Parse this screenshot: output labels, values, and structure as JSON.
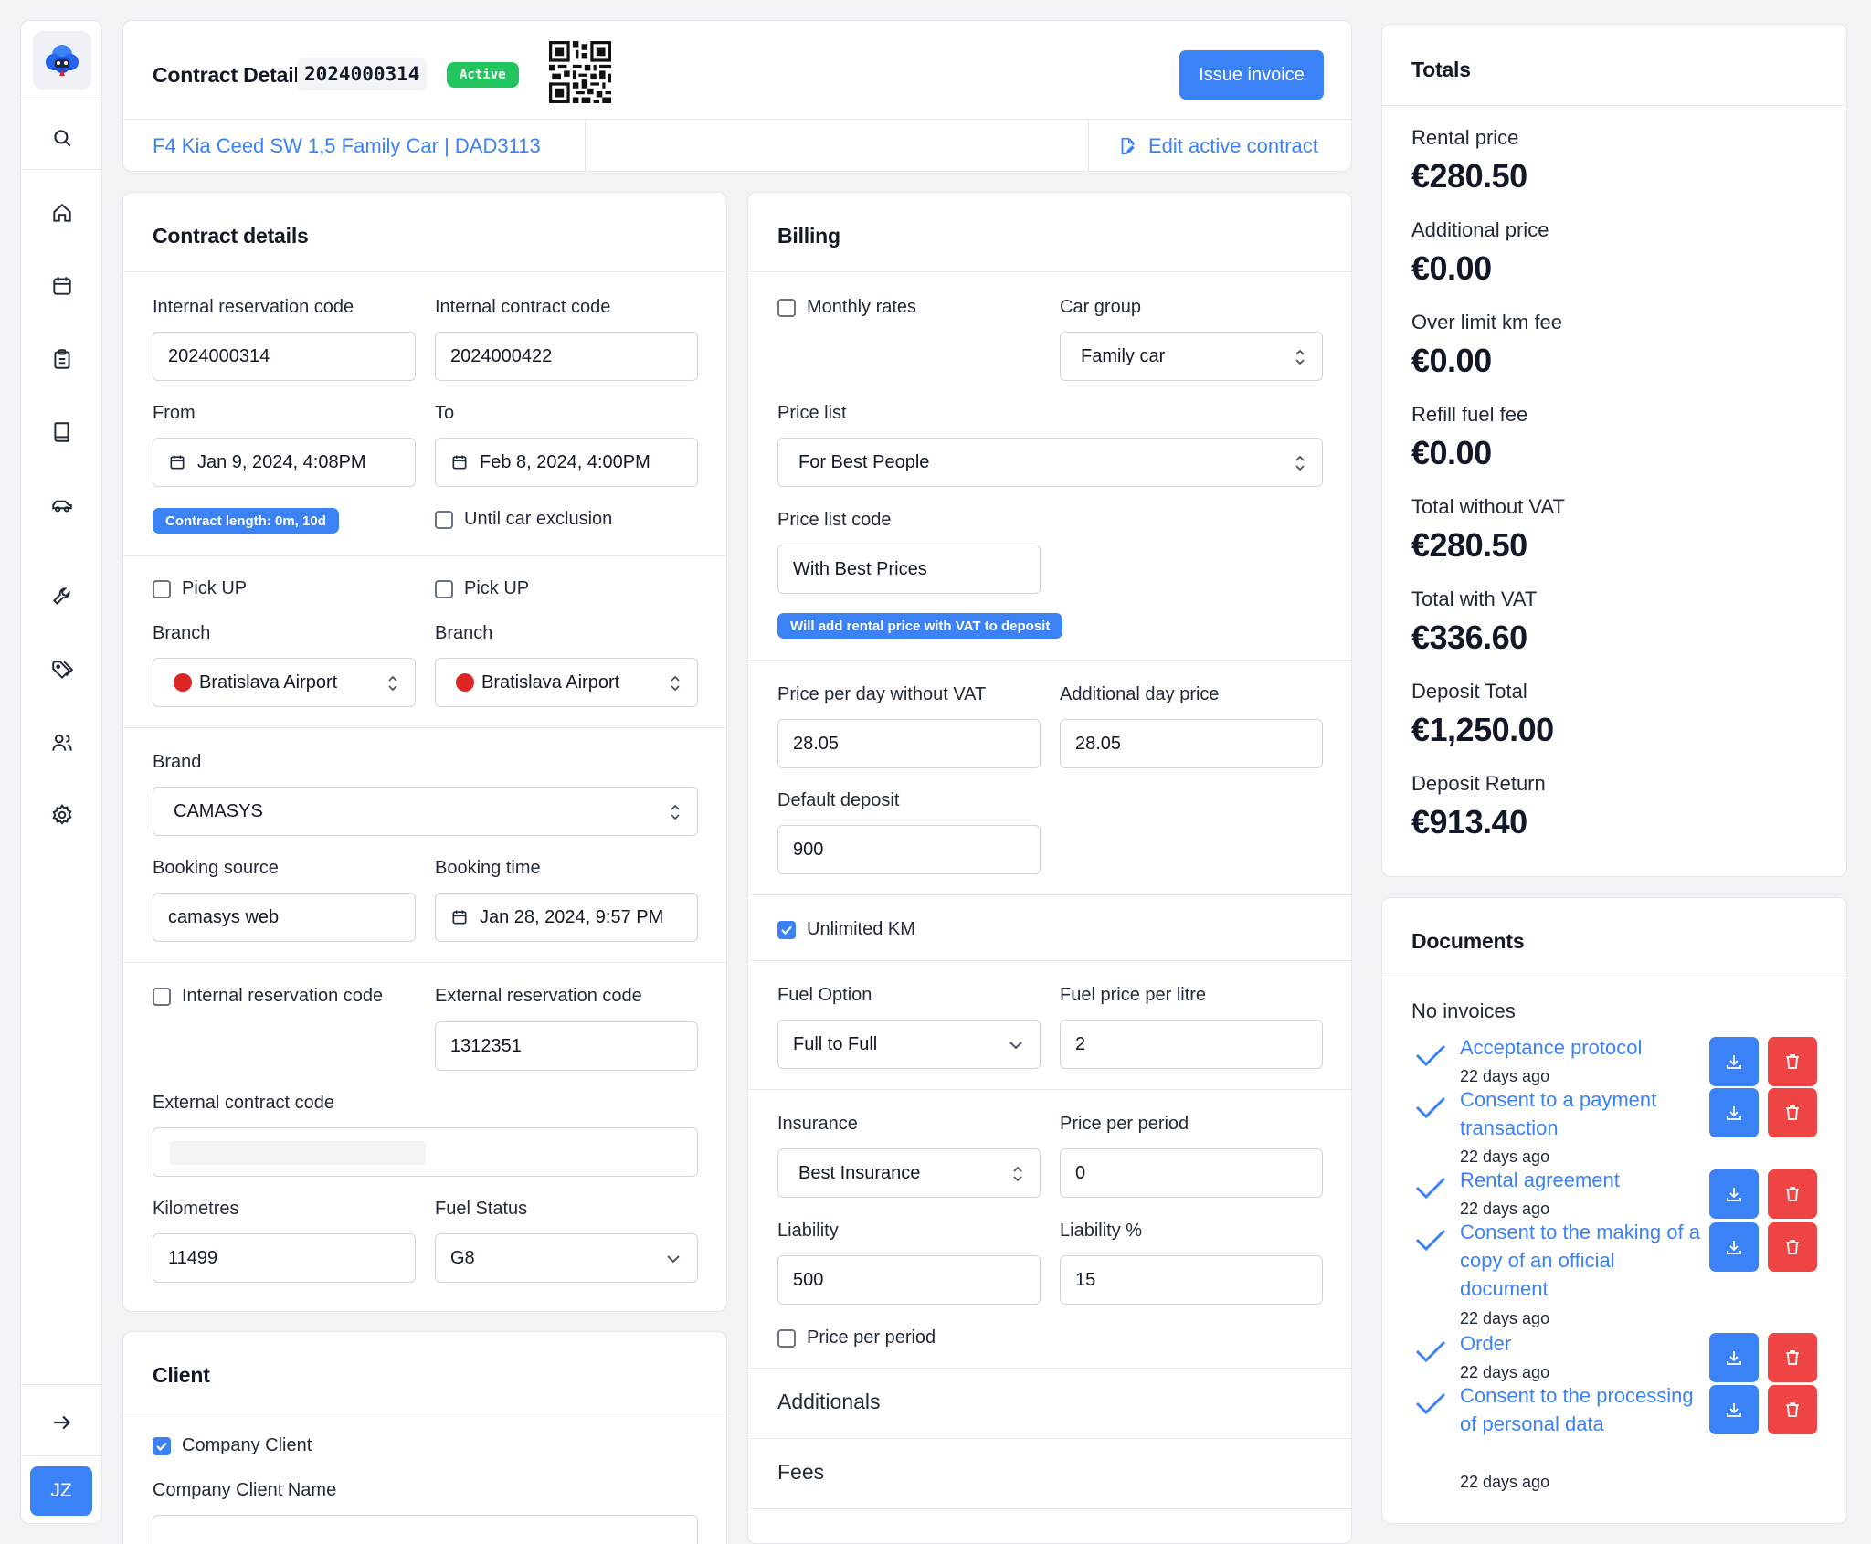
{
  "user": {
    "initials": "JZ"
  },
  "header": {
    "title": "Contract Detail",
    "contract_number": "2024000314",
    "status": "Active",
    "issue_invoice_label": "Issue invoice",
    "car_link": "F4 Kia Ceed SW 1,5 Family Car | DAD3113",
    "edit_label": "Edit active contract"
  },
  "contract_details": {
    "title": "Contract details",
    "internal_reservation_code_label": "Internal reservation code",
    "internal_reservation_code": "2024000314",
    "internal_contract_code_label": "Internal contract code",
    "internal_contract_code": "2024000422",
    "from_label": "From",
    "from_value": "Jan 9, 2024, 4:08PM",
    "to_label": "To",
    "to_value": "Feb 8, 2024, 4:00PM",
    "contract_length": "Contract length: 0m, 10d",
    "until_car_exclusion_label": "Until car exclusion",
    "pickup_label_1": "Pick UP",
    "pickup_label_2": "Pick UP",
    "branch_label_1": "Branch",
    "branch_label_2": "Branch",
    "branch_1": "Bratislava Airport",
    "branch_2": "Bratislava Airport",
    "brand_label": "Brand",
    "brand": "CAMASYS",
    "booking_source_label": "Booking source",
    "booking_source": "camasys web",
    "booking_time_label": "Booking time",
    "booking_time": "Jan 28, 2024, 9:57 PM",
    "internal_reservation_cb_label": "Internal reservation code",
    "external_reservation_code_label": "External reservation code",
    "external_reservation_code": "1312351",
    "external_contract_code_label": "External contract code",
    "external_contract_code": "",
    "kilometres_label": "Kilometres",
    "kilometres": "11499",
    "fuel_status_label": "Fuel Status",
    "fuel_status": "G8"
  },
  "client": {
    "title": "Client",
    "company_client_label": "Company Client",
    "company_client_name_label": "Company Client Name"
  },
  "billing": {
    "title": "Billing",
    "monthly_rates_label": "Monthly rates",
    "car_group_label": "Car group",
    "car_group": "Family car",
    "price_list_label": "Price list",
    "price_list": "For Best People",
    "price_list_code_label": "Price list code",
    "price_list_code": "With Best Prices",
    "deposit_note": "Will add rental price with VAT to deposit",
    "price_per_day_label": "Price per day without VAT",
    "price_per_day": "28.05",
    "additional_day_price_label": "Additional day price",
    "additional_day_price": "28.05",
    "default_deposit_label": "Default deposit",
    "default_deposit": "900",
    "unlimited_km_label": "Unlimited KM",
    "fuel_option_label": "Fuel Option",
    "fuel_option": "Full to Full",
    "fuel_price_label": "Fuel price per litre",
    "fuel_price": "2",
    "insurance_label": "Insurance",
    "insurance": "Best Insurance",
    "price_per_period_label": "Price per period",
    "price_per_period": "0",
    "liability_label": "Liability",
    "liability": "500",
    "liability_pct_label": "Liability %",
    "liability_pct": "15",
    "price_per_period_cb_label": "Price per period",
    "additionals_label": "Additionals",
    "fees_label": "Fees"
  },
  "totals": {
    "title": "Totals",
    "items": [
      {
        "label": "Rental price",
        "value": "€280.50"
      },
      {
        "label": "Additional price",
        "value": "€0.00"
      },
      {
        "label": "Over limit km fee",
        "value": "€0.00"
      },
      {
        "label": "Refill fuel fee",
        "value": "€0.00"
      },
      {
        "label": "Total without VAT",
        "value": "€280.50"
      },
      {
        "label": "Total with VAT",
        "value": "€336.60"
      },
      {
        "label": "Deposit Total",
        "value": "€1,250.00"
      },
      {
        "label": "Deposit Return",
        "value": "€913.40"
      }
    ]
  },
  "documents": {
    "title": "Documents",
    "no_invoices": "No invoices",
    "items": [
      {
        "name": "Acceptance protocol",
        "time": "22 days ago"
      },
      {
        "name": "Consent to a payment transaction",
        "time": "22 days ago"
      },
      {
        "name": "Rental agreement",
        "time": "22 days ago"
      },
      {
        "name": "Consent to the making of a copy of an official document",
        "time": "22 days ago"
      },
      {
        "name": "Order",
        "time": "22 days ago"
      },
      {
        "name": "Consent to the processing of personal data",
        "time": "22 days ago"
      }
    ]
  },
  "colors": {
    "primary": "#3b82f6",
    "danger": "#ef4444",
    "success": "#22c55e"
  },
  "icons": [
    "search-icon",
    "home-icon",
    "calendar-icon",
    "clipboard-icon",
    "book-icon",
    "car-icon",
    "wrench-icon",
    "tag-icon",
    "users-icon",
    "gear-icon",
    "arrow-right-icon",
    "qr-code-icon",
    "file-edit-icon",
    "download-icon",
    "trash-icon",
    "check-icon"
  ]
}
